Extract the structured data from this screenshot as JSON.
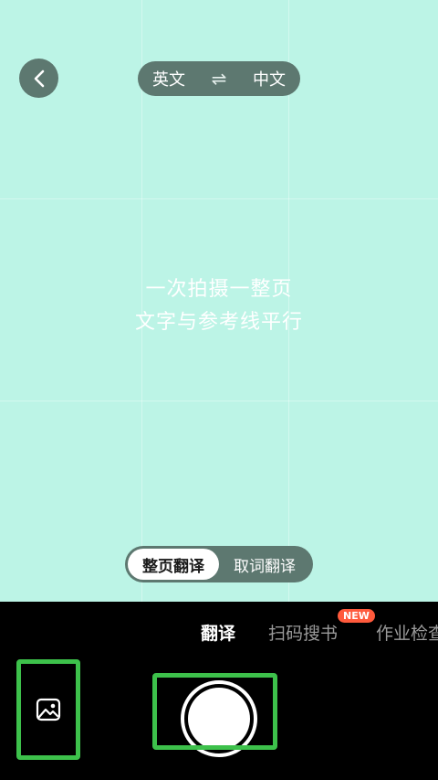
{
  "header": {
    "source_lang": "英文",
    "swap_symbol": "⇌",
    "target_lang": "中文"
  },
  "hint": {
    "line1": "一次拍摄一整页",
    "line2": "文字与参考线平行"
  },
  "mode_toggle": {
    "active": "整页翻译",
    "inactive": "取词翻译"
  },
  "tabs": [
    {
      "label": "翻译",
      "active": true
    },
    {
      "label": "扫码搜书",
      "active": false
    },
    {
      "label": "作业检查",
      "active": false
    }
  ],
  "badge": "NEW",
  "colors": {
    "viewfinder": "#bcf4e6",
    "pill": "#5d7870",
    "highlight": "#3dc14b",
    "badge": "#ff5a3c"
  },
  "icons": [
    "back-chevron-icon",
    "gallery-image-icon",
    "shutter-icon"
  ]
}
